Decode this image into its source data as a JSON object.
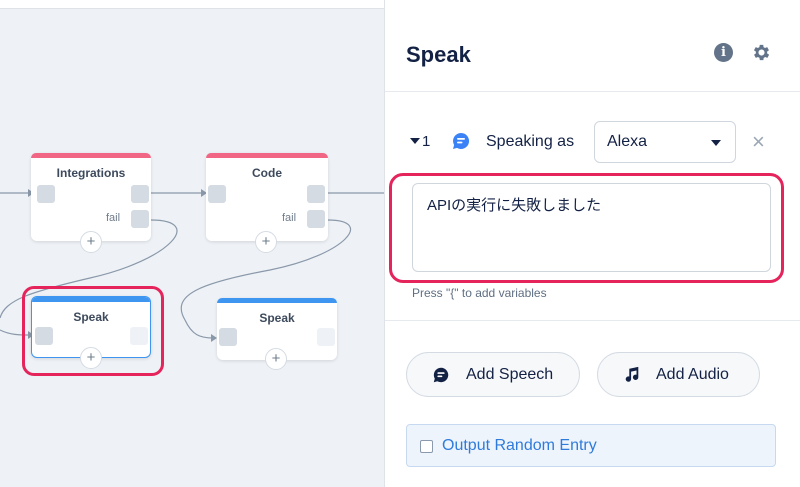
{
  "canvas": {
    "nodes": [
      {
        "title": "Integrations",
        "fail_label": "fail",
        "plus": "+"
      },
      {
        "title": "Code",
        "fail_label": "fail",
        "plus": "+"
      },
      {
        "title": "Speak",
        "plus": "+"
      },
      {
        "title": "Speak",
        "plus": "+"
      }
    ],
    "colors": {
      "integration_bar": "#f06684",
      "speak_bar": "#3f96f0",
      "highlight": "#e5245c"
    }
  },
  "panel": {
    "title": "Speak",
    "info_icon": "i",
    "speech": {
      "index": "1",
      "speaking_as_label": "Speaking as",
      "voice_selected": "Alexa",
      "close_icon": "×",
      "text": "APIの実行に失敗しました",
      "hint": "Press \"{\" to add variables"
    },
    "add_speech_label": "Add Speech",
    "add_audio_label": "Add Audio",
    "random_entry_label": "Output Random Entry"
  }
}
